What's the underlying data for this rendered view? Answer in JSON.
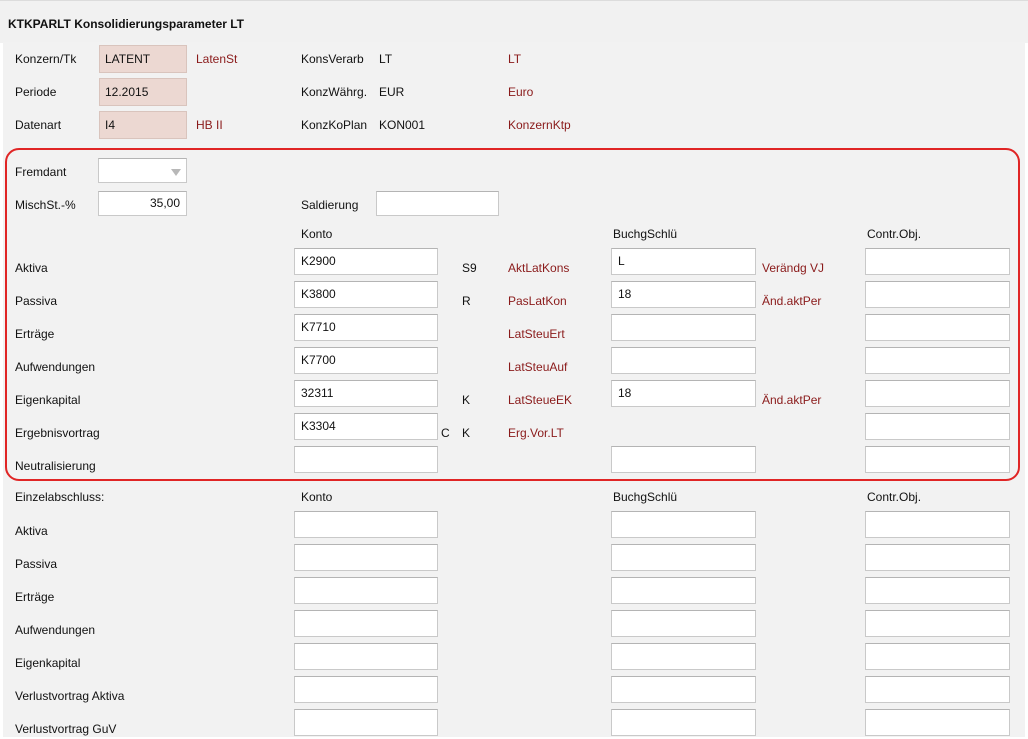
{
  "title": "KTKPARLT Konsolidierungsparameter LT",
  "header": {
    "konzern_label": "Konzern/Tk",
    "konzern_value": "LATENT",
    "konzern_desc": "LatenSt",
    "periode_label": "Periode",
    "periode_value": "12.2015",
    "datenart_label": "Datenart",
    "datenart_value": "I4",
    "datenart_desc": "HB II",
    "konsverarb_label": "KonsVerarb",
    "konsverarb_value": "LT",
    "konsverarb_desc": "LT",
    "konzwaehrg_label": "KonzWährg.",
    "konzwaehrg_value": "EUR",
    "konzwaehrg_desc": "Euro",
    "konzkoplan_label": "KonzKoPlan",
    "konzkoplan_value": "KON001",
    "konzkoplan_desc": "KonzernKtp"
  },
  "params": {
    "fremdant_label": "Fremdant",
    "fremdant_value": "",
    "mischst_label": "MischSt.-%",
    "mischst_value": "35,00",
    "saldierung_label": "Saldierung",
    "saldierung_value": ""
  },
  "columns": {
    "konto": "Konto",
    "buchgschlue": "BuchgSchlü",
    "contr_obj": "Contr.Obj."
  },
  "konsolidierung": [
    {
      "label": "Aktiva",
      "konto": "K2900",
      "flag1": "",
      "flag2": "S9",
      "desc": "AktLatKons",
      "buchg": "L",
      "desc2": "Verändg VJ",
      "contr": ""
    },
    {
      "label": "Passiva",
      "konto": "K3800",
      "flag1": "",
      "flag2": "R",
      "desc": "PasLatKon",
      "buchg": "18",
      "desc2": "Änd.aktPer",
      "contr": ""
    },
    {
      "label": "Erträge",
      "konto": "K7710",
      "flag1": "",
      "flag2": "",
      "desc": "LatSteuErt",
      "buchg": "",
      "desc2": "",
      "contr": ""
    },
    {
      "label": "Aufwendungen",
      "konto": "K7700",
      "flag1": "",
      "flag2": "",
      "desc": "LatSteuAuf",
      "buchg": "",
      "desc2": "",
      "contr": ""
    },
    {
      "label": "Eigenkapital",
      "konto": "32311",
      "flag1": "",
      "flag2": "K",
      "desc": "LatSteueEK",
      "buchg": "18",
      "desc2": "Änd.aktPer",
      "contr": ""
    },
    {
      "label": "Ergebnisvortrag",
      "konto": "K3304",
      "flag1": "C",
      "flag2": "K",
      "desc": "Erg.Vor.LT",
      "buchg": "",
      "desc2": "",
      "contr": ""
    },
    {
      "label": "Neutralisierung",
      "konto": "",
      "flag1": "",
      "flag2": "",
      "desc": "",
      "buchg": "",
      "desc2": "",
      "contr": ""
    }
  ],
  "einzel": {
    "section_label": "Einzelabschluss:",
    "rows": [
      {
        "label": "Aktiva",
        "konto": "",
        "buchg": "",
        "contr": ""
      },
      {
        "label": "Passiva",
        "konto": "",
        "buchg": "",
        "contr": ""
      },
      {
        "label": "Erträge",
        "konto": "",
        "buchg": "",
        "contr": ""
      },
      {
        "label": "Aufwendungen",
        "konto": "",
        "buchg": "",
        "contr": ""
      },
      {
        "label": "Eigenkapital",
        "konto": "",
        "buchg": "",
        "contr": ""
      },
      {
        "label": "Verlustvortrag Aktiva",
        "konto": "",
        "buchg": "",
        "contr": ""
      },
      {
        "label": "Verlustvortrag GuV",
        "konto": "",
        "buchg": "",
        "contr": ""
      }
    ]
  },
  "colors": {
    "accent_text": "#8a1a1a",
    "highlight": "#e02525",
    "readonly_bg": "#ecd8d2",
    "panel_bg": "#f2f2f2"
  }
}
